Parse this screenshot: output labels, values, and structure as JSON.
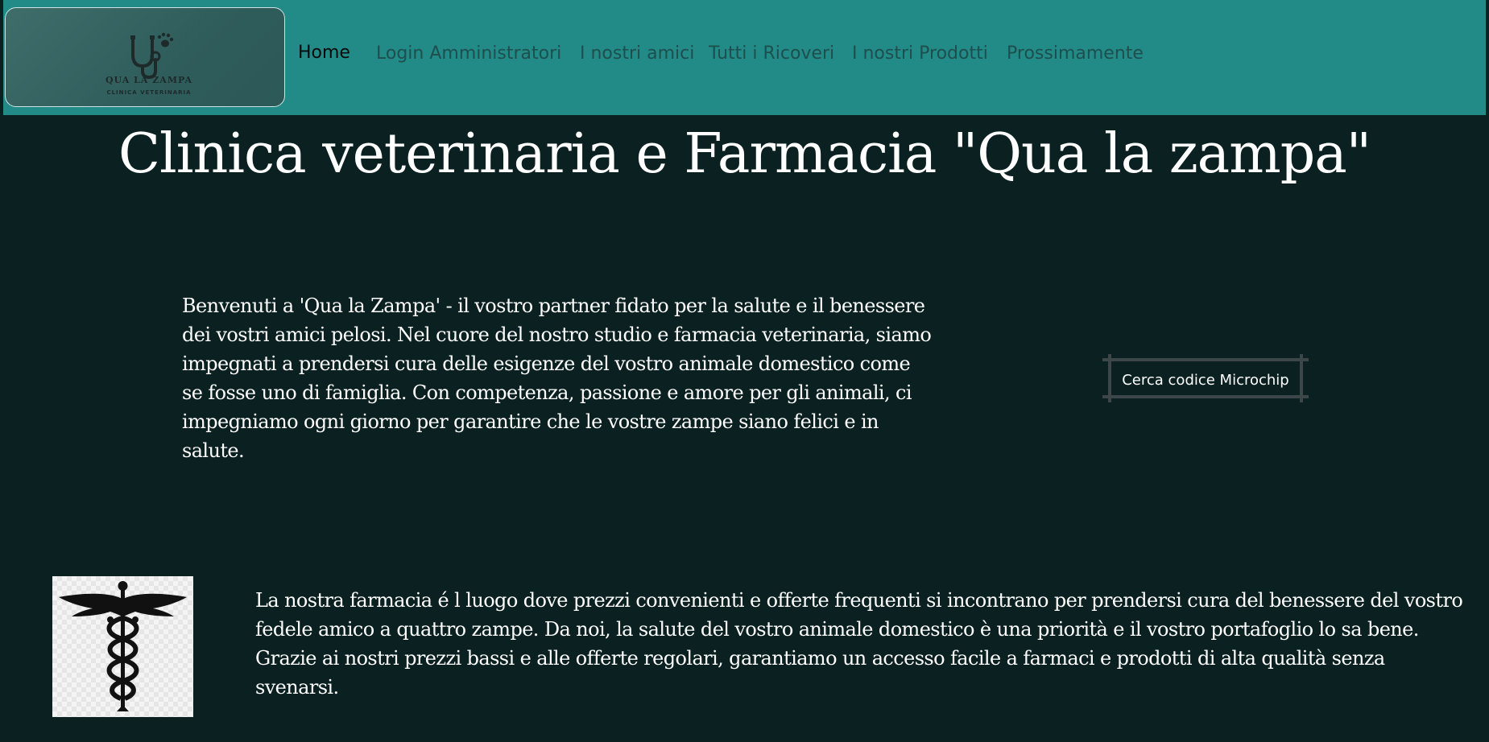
{
  "brand": {
    "logo_title": "QUA LA ZAMPA",
    "logo_subtitle": "CLINICA VETERINARIA",
    "icon": "stethoscope-paw-icon"
  },
  "nav": {
    "items": [
      {
        "label": "Home",
        "active": true
      },
      {
        "label": "Login Amministratori",
        "active": false
      },
      {
        "label": "I nostri amici",
        "active": false
      },
      {
        "label": "Tutti i Ricoveri",
        "active": false
      },
      {
        "label": "I nostri Prodotti",
        "active": false
      },
      {
        "label": "Prossimamente",
        "active": false
      }
    ]
  },
  "hero": {
    "title": "Clinica veterinaria e Farmacia \"Qua la zampa\""
  },
  "intro": {
    "text": "Benvenuti a 'Qua la Zampa' - il vostro partner fidato per la salute e il benessere dei vostri amici pelosi. Nel cuore del nostro studio e farmacia veterinaria, siamo impegnati a prendersi cura delle esigenze del vostro animale domestico come se fosse uno di famiglia. Con competenza, passione e amore per gli animali, ci impegniamo ogni giorno per garantire che le vostre zampe siano felici e in salute."
  },
  "microchip": {
    "button_label": "Cerca codice Microchip"
  },
  "pharmacy": {
    "icon": "caduceus-icon",
    "text": "La nostra farmacia é l luogo dove prezzi convenienti e offerte frequenti si incontrano per prendersi cura del benessere del vostro fedele amico a quattro zampe. Da noi, la salute del vostro animale domestico è una priorità e il vostro portafoglio lo sa bene. Grazie ai nostri prezzi bassi e alle offerte regolari, garantiamo un accesso facile a farmaci e prodotti di alta qualità senza svenarsi."
  },
  "colors": {
    "header_bg": "#228a87",
    "page_bg": "#0b2020",
    "text": "#ffffff",
    "nav_text": "#1e4f4e"
  }
}
